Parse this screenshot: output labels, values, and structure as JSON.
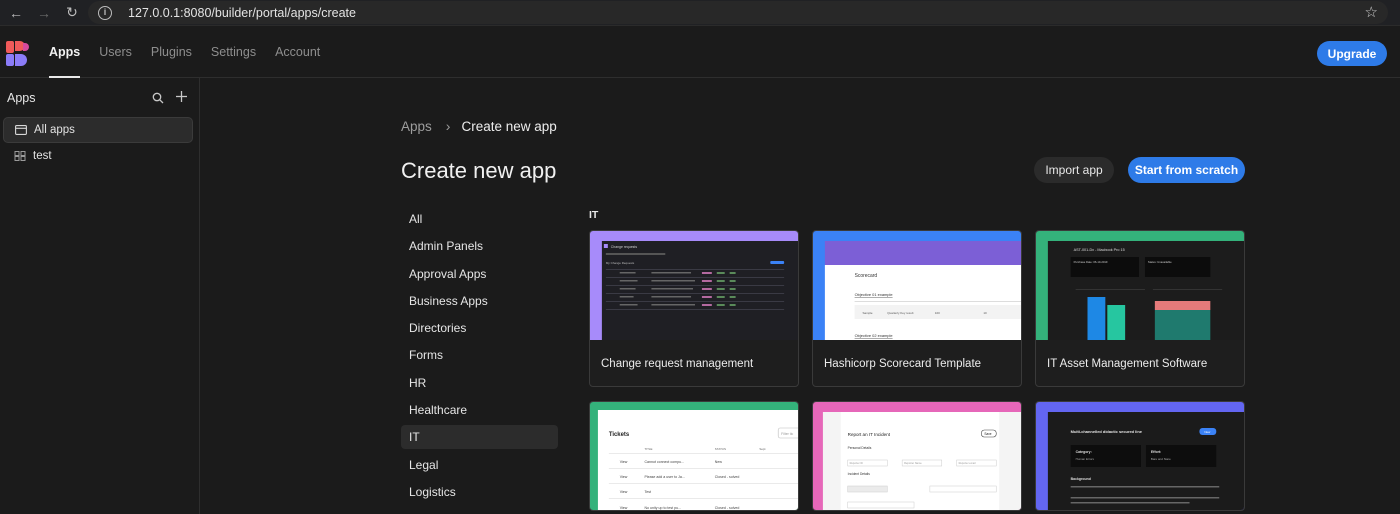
{
  "browser": {
    "url": "127.0.0.1:8080/builder/portal/apps/create"
  },
  "topnav": {
    "tabs": [
      "Apps",
      "Users",
      "Plugins",
      "Settings",
      "Account"
    ],
    "upgrade_label": "Upgrade"
  },
  "sidebar": {
    "title": "Apps",
    "items": [
      {
        "label": "All apps",
        "icon": "window-icon"
      },
      {
        "label": "test",
        "icon": "grid-icon"
      }
    ]
  },
  "main": {
    "breadcrumb": [
      "Apps",
      "Create new app"
    ],
    "title": "Create new app",
    "import_label": "Import app",
    "scratch_label": "Start from scratch",
    "categories": [
      "All",
      "Admin Panels",
      "Approval Apps",
      "Business Apps",
      "Directories",
      "Forms",
      "HR",
      "Healthcare",
      "IT",
      "Legal",
      "Logistics"
    ],
    "active_category": "IT",
    "section": "IT",
    "templates": [
      {
        "name": "Change request management",
        "accent": "#a78bfa"
      },
      {
        "name": "Hashicorp Scorecard Template",
        "accent": "#3b82f6"
      },
      {
        "name": "IT Asset Management Software",
        "accent": "#34b27b"
      },
      {
        "name": "",
        "accent": "#34b27b"
      },
      {
        "name": "",
        "accent": "#e667b9"
      },
      {
        "name": "",
        "accent": "#6366f1"
      }
    ],
    "previews": {
      "change_request": {
        "title": "Change requests",
        "subtitle": "My Change Requests"
      },
      "scorecard": {
        "title": "Scorecard",
        "objective1": "Objective 01 example",
        "objective2": "Objective 02 example",
        "row": [
          "Sample",
          "Quarterly Key result",
          "100",
          "10"
        ]
      },
      "asset": {
        "title": "AST-001-Dx - Macbook Pro 15",
        "stat1_title": "Purchase Date: 06-10-2019",
        "stat2_title": "Status: Unavailable"
      },
      "tickets": {
        "title": "Tickets",
        "filter": "Filter tic",
        "headers": [
          "TITLE",
          "STATUS",
          "Sept"
        ],
        "rows": [
          [
            "View",
            "Cannot connect compu...",
            "New"
          ],
          [
            "View",
            "Please add a user to Ja...",
            "Closed - solved"
          ],
          [
            "View",
            "Test",
            ""
          ],
          [
            "View",
            "No unity up to test pu...",
            "Closed - solved"
          ]
        ]
      },
      "incident": {
        "title": "Report an IT Incident",
        "save": "Save",
        "personal": "Personal Details",
        "incident": "Incident Details",
        "fields": [
          "Reporter ID",
          "Reporter Name",
          "Reporter email"
        ]
      },
      "multichannel": {
        "title": "Multi-channelled didactic secured line",
        "badge": "New",
        "category_label": "Category:",
        "category_value": "Human Errors",
        "effort_label": "Effort:",
        "effort_value": "Bare and Stare",
        "background": "Background"
      }
    }
  }
}
